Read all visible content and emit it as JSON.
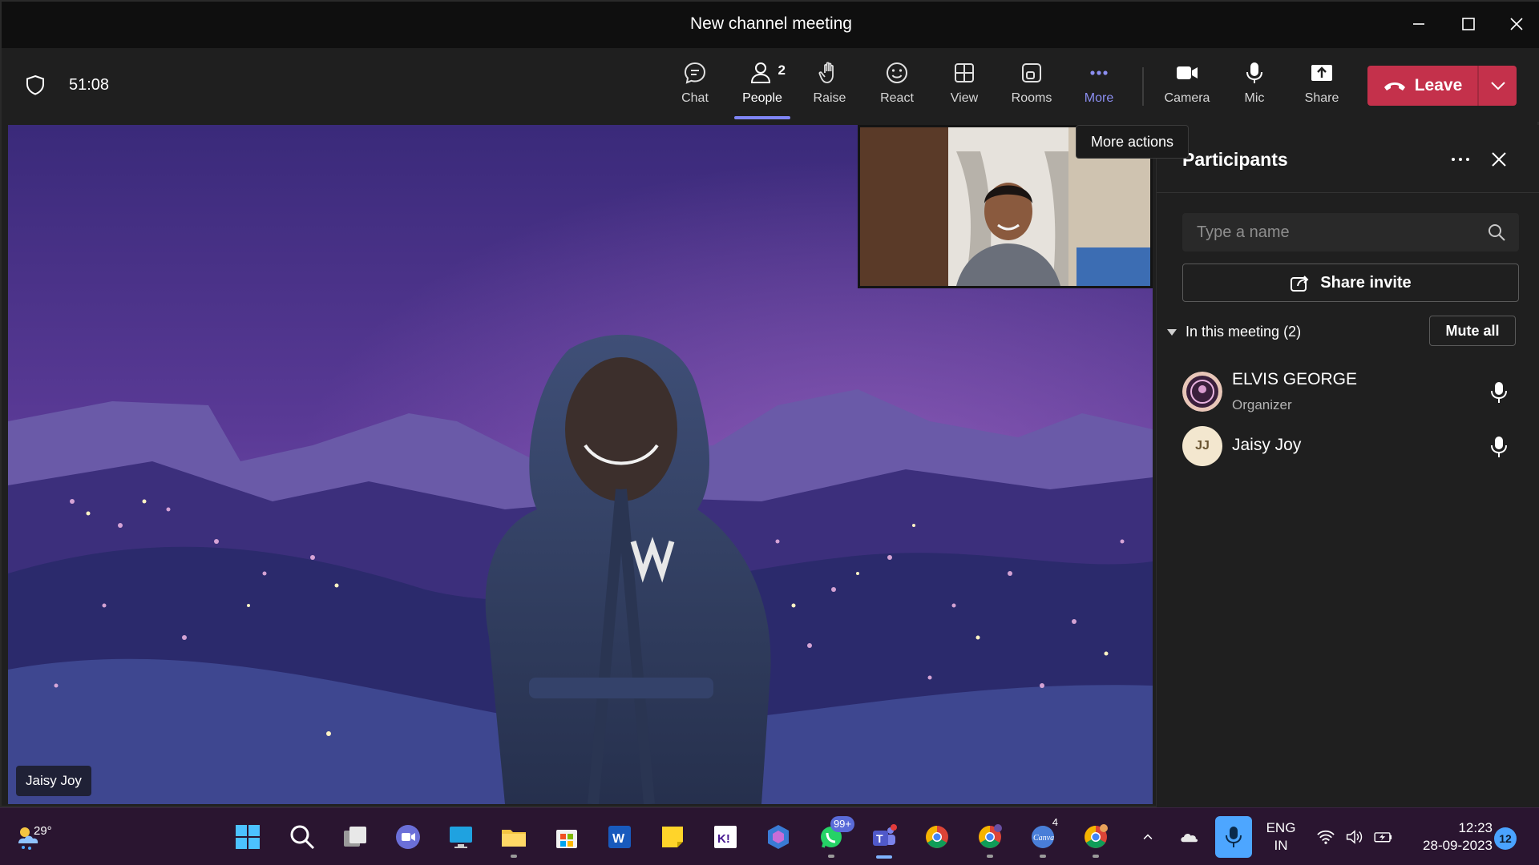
{
  "window": {
    "title": "New channel meeting"
  },
  "toolbar": {
    "timer": "51:08",
    "buttons": [
      {
        "label": "Chat",
        "icon": "chat-icon"
      },
      {
        "label": "People",
        "icon": "people-icon",
        "count": "2",
        "active": true
      },
      {
        "label": "Raise",
        "icon": "raise-hand-icon"
      },
      {
        "label": "React",
        "icon": "react-icon"
      },
      {
        "label": "View",
        "icon": "view-icon"
      },
      {
        "label": "Rooms",
        "icon": "rooms-icon"
      },
      {
        "label": "More",
        "icon": "more-icon"
      },
      {
        "label": "Camera",
        "icon": "camera-icon"
      },
      {
        "label": "Mic",
        "icon": "mic-icon"
      },
      {
        "label": "Share",
        "icon": "share-icon"
      }
    ],
    "leave_label": "Leave",
    "tooltip": "More actions"
  },
  "stage": {
    "name_tag": "Jaisy Joy"
  },
  "panel": {
    "title": "Participants",
    "search_placeholder": "Type a name",
    "share_invite": "Share invite",
    "section_label": "In this meeting (2)",
    "mute_all": "Mute all",
    "participants": [
      {
        "name": "ELVIS GEORGE",
        "role": "Organizer",
        "initials": ""
      },
      {
        "name": "Jaisy Joy",
        "role": "",
        "initials": "JJ"
      }
    ]
  },
  "taskbar": {
    "temperature": "29°",
    "teams_badge": "99+",
    "canva_badge": "4",
    "lang_line1": "ENG",
    "lang_line2": "IN",
    "time": "12:23",
    "date": "28-09-2023",
    "notifications": "12"
  },
  "colors": {
    "accent": "#7f85f5",
    "leave": "#c4314b",
    "toolbar_bg": "#1f1f1f",
    "titlebar_bg": "#0f0f0f",
    "taskbar_bg": "#2a1530"
  }
}
